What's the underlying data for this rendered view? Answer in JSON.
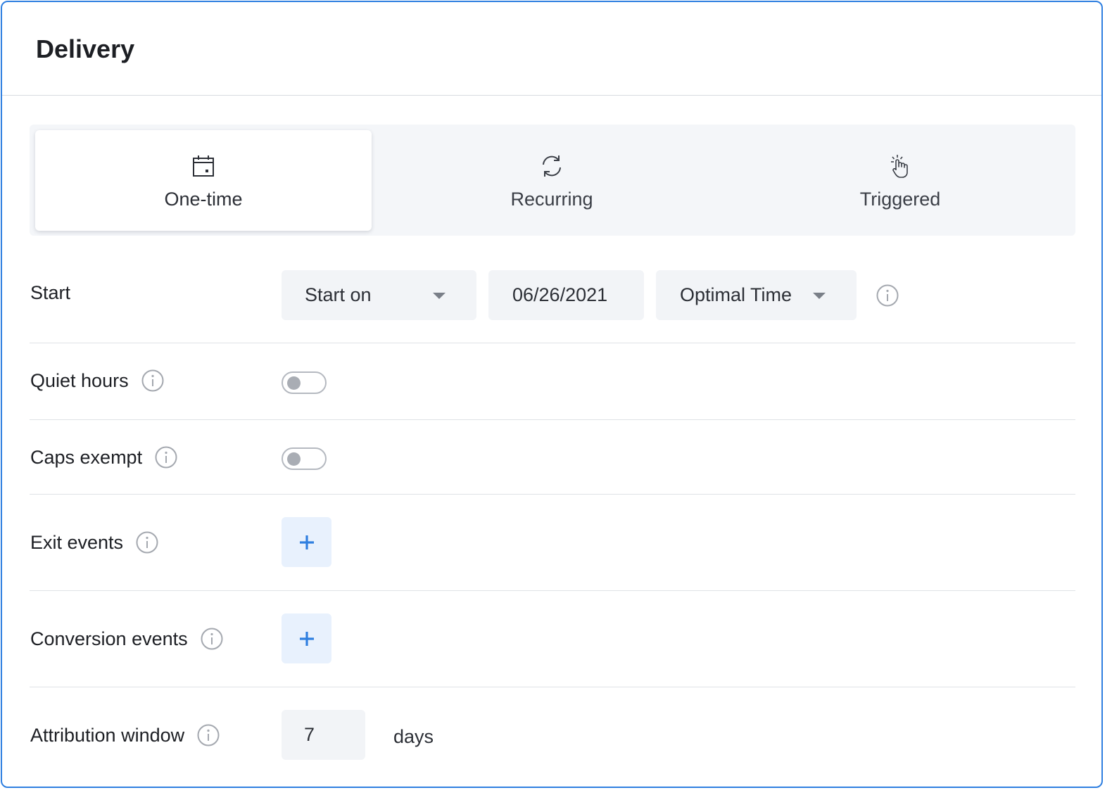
{
  "panel": {
    "title": "Delivery"
  },
  "tabs": [
    {
      "label": "One-time",
      "icon": "calendar-icon",
      "active": true
    },
    {
      "label": "Recurring",
      "icon": "refresh-icon",
      "active": false
    },
    {
      "label": "Triggered",
      "icon": "hand-pointer-click-icon",
      "active": false
    }
  ],
  "start": {
    "label": "Start",
    "mode": "Start on",
    "date": "06/26/2021",
    "time": "Optimal Time"
  },
  "quiet_hours": {
    "label": "Quiet hours",
    "enabled": false
  },
  "caps_exempt": {
    "label": "Caps exempt",
    "enabled": false
  },
  "exit_events": {
    "label": "Exit events"
  },
  "conversion_events": {
    "label": "Conversion events"
  },
  "attribution_window": {
    "label": "Attribution window",
    "value": "7",
    "unit": "days"
  },
  "colors": {
    "accent": "#2f7fe0",
    "add_button_bg": "#e8f1fd",
    "field_bg": "#f2f4f7",
    "tabs_bg": "#f4f6f9"
  }
}
